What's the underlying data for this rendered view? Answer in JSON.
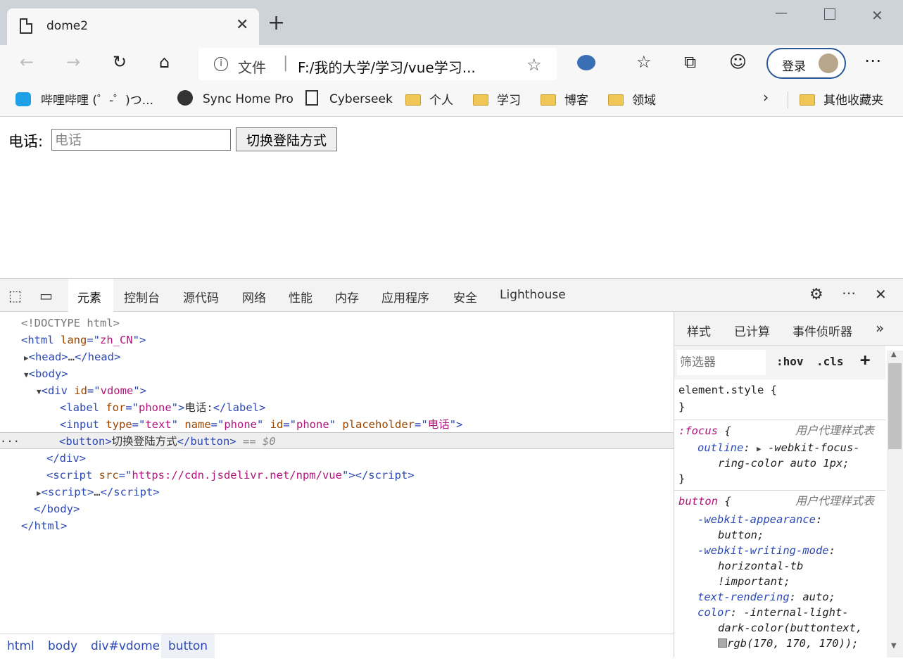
{
  "browser": {
    "tab_title": "dome2",
    "login_label": "登录",
    "address": {
      "file_label": "文件",
      "url": "F:/我的大学/学习/vue学习..."
    }
  },
  "bookmarks": [
    {
      "label": "哔哩哔哩 (゜-゜)つ...",
      "icon": "bilibili-icon"
    },
    {
      "label": "Sync Home Pro",
      "icon": "sync-icon"
    },
    {
      "label": "Cyberseek",
      "icon": "page-icon"
    },
    {
      "label": "个人",
      "icon": "folder-icon"
    },
    {
      "label": "学习",
      "icon": "folder-icon"
    },
    {
      "label": "博客",
      "icon": "folder-icon"
    },
    {
      "label": "领域",
      "icon": "folder-icon"
    },
    {
      "label": "其他收藏夹",
      "icon": "folder-icon"
    }
  ],
  "page": {
    "label": "电话:",
    "input_placeholder": "电话",
    "button_label": "切换登陆方式"
  },
  "devtools": {
    "tabs": [
      "元素",
      "控制台",
      "源代码",
      "网络",
      "性能",
      "内存",
      "应用程序",
      "安全",
      "Lighthouse"
    ],
    "breadcrumb": [
      "html",
      "body",
      "div#vdome",
      "button"
    ],
    "styles_tabs": [
      "样式",
      "已计算",
      "事件侦听器"
    ],
    "filter_placeholder": "筛选器",
    "hov": ":hov",
    "cls": ".cls",
    "ua_label": "用户代理样式表",
    "selected_marker": "== $0"
  },
  "colors": {
    "accent": "#0f6cbd",
    "tag": "#2c48b3",
    "attr_value": "#b0147a"
  }
}
